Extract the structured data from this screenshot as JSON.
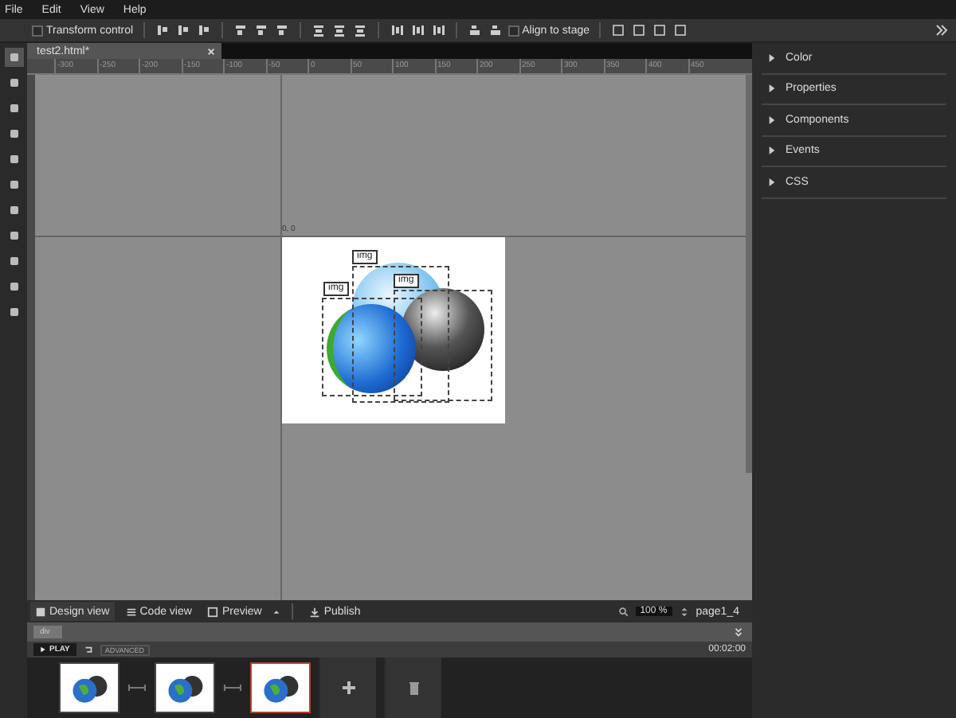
{
  "menu": [
    "File",
    "Edit",
    "View",
    "Help"
  ],
  "toolbar": {
    "transform_control": {
      "label": "Transform control",
      "checked": false
    },
    "align_to_stage": {
      "label": "Align to stage",
      "checked": false
    }
  },
  "tools": [
    {
      "selected": true
    },
    {
      "selected": false
    },
    {
      "selected": false
    },
    {
      "selected": false
    },
    {
      "selected": false
    },
    {
      "selected": false
    },
    {
      "selected": false
    },
    {
      "selected": false
    },
    {
      "selected": false
    },
    {
      "selected": false
    },
    {
      "selected": false
    }
  ],
  "document_tab": {
    "title": "test2.html*"
  },
  "ruler": [
    "-300",
    "-250",
    "-200",
    "-150",
    "-100",
    "-50",
    "0",
    "50",
    "100",
    "150",
    "200",
    "250",
    "300",
    "350",
    "400",
    "450"
  ],
  "stage": {
    "origin": "0, 0",
    "elements": [
      {
        "label": "img",
        "kind": "light-globe"
      },
      {
        "label": "img",
        "kind": "earth-globe"
      },
      {
        "label": "img",
        "kind": "dark-globe"
      }
    ]
  },
  "panels": [
    {
      "title": "Color",
      "expanded": false
    },
    {
      "title": "Properties",
      "expanded": false
    },
    {
      "title": "Components",
      "expanded": false
    },
    {
      "title": "Events",
      "expanded": false
    },
    {
      "title": "CSS",
      "expanded": false
    }
  ],
  "views": [
    {
      "label": "Design view",
      "kind": "design",
      "selected": true
    },
    {
      "label": "Code view",
      "kind": "code",
      "selected": false
    },
    {
      "label": "Preview",
      "kind": "preview",
      "selected": false
    }
  ],
  "publish": "Publish",
  "zoom": "100 %",
  "page": "page1_4",
  "breadcrumb": [
    "div"
  ],
  "timeline": {
    "play": "PLAY",
    "mode": "ADVANCED",
    "time": "00:02:00",
    "frames": [
      {
        "selected": false
      },
      {
        "selected": false
      },
      {
        "selected": true
      }
    ]
  }
}
